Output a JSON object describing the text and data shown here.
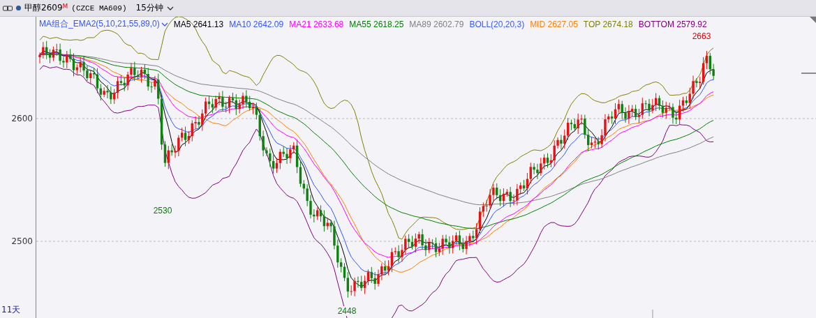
{
  "header": {
    "symbol": "甲醇2609",
    "badge": "M",
    "code": "(CZCE MA609)",
    "period": "15分钟"
  },
  "legend": {
    "indicator": "MA组合_EMA2(5,10,21,55,89,0)",
    "items": [
      {
        "text": "MA5 2641.13",
        "color": "#000000"
      },
      {
        "text": "MA10 2642.09",
        "color": "#3355ff"
      },
      {
        "text": "MA21 2633.68",
        "color": "#ff00ff"
      },
      {
        "text": "MA55 2618.25",
        "color": "#008000"
      },
      {
        "text": "MA89 2602.79",
        "color": "#808080"
      },
      {
        "text": "BOLL(20,20,3)",
        "color": "#3a5aff"
      },
      {
        "text": "MID 2627.05",
        "color": "#ff8000"
      },
      {
        "text": "TOP 2674.18",
        "color": "#808000"
      },
      {
        "text": "BOTTOM 2579.92",
        "color": "#800080"
      }
    ]
  },
  "y_axis": [
    "2600",
    "2500"
  ],
  "price_labels": [
    {
      "text": "2663",
      "color": "#e00000"
    },
    {
      "text": "2530",
      "color": "#008000"
    },
    {
      "text": "2448",
      "color": "#008000"
    }
  ],
  "footer": {
    "range": "11天"
  }
}
